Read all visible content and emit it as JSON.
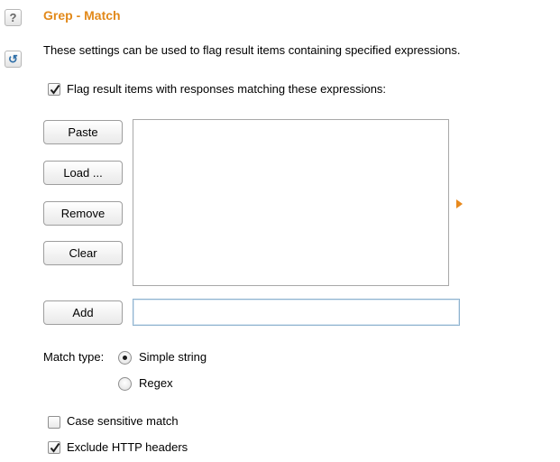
{
  "sidebar": {
    "help_glyph": "?",
    "reset_glyph": "↺"
  },
  "section": {
    "title": "Grep - Match",
    "description": "These settings can be used to flag result items containing specified expressions.",
    "flag_label": "Flag result items with responses matching these expressions:",
    "flag_checked": true
  },
  "buttons": {
    "paste": "Paste",
    "load": "Load ...",
    "remove": "Remove",
    "clear": "Clear",
    "add": "Add"
  },
  "expressions": [],
  "add_input_value": "",
  "match_type": {
    "label": "Match type:",
    "options": [
      "Simple string",
      "Regex"
    ],
    "selected": "Simple string"
  },
  "options": {
    "case_sensitive_label": "Case sensitive match",
    "case_sensitive_checked": false,
    "exclude_headers_label": "Exclude HTTP headers",
    "exclude_headers_checked": true
  },
  "colors": {
    "title": "#e2891a",
    "arrow": "#e8891d"
  }
}
